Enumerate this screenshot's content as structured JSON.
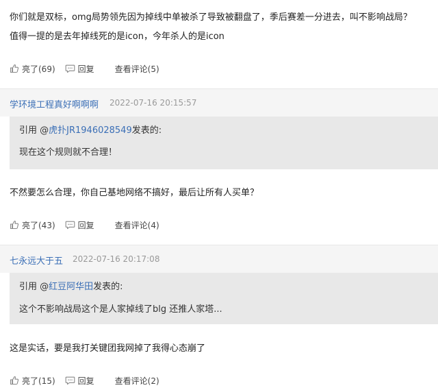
{
  "post_top": {
    "line1": "你们就是双标，omg局势领先因为掉线中单被杀了导致被翻盘了，季后赛差一分进去，叫不影响战局？",
    "line2": "值得一提的是去年掉线死的是icon，今年杀人的是icon",
    "like_label": "亮了(69)",
    "reply_label": "回复",
    "view_label": "查看评论(5)"
  },
  "post2": {
    "author": "学环境工程真好啊啊啊",
    "time": "2022-07-16 20:15:57",
    "quote_prefix": "引用 @",
    "quote_user": "虎扑JR1946028549",
    "quote_suffix": "发表的:",
    "quote_text": "现在这个规则就不合理！",
    "text": "不然要怎么合理，你自己基地网络不搞好，最后让所有人买单？",
    "like_label": "亮了(43)",
    "reply_label": "回复",
    "view_label": "查看评论(4)"
  },
  "post3": {
    "author": "七永远大于五",
    "time": "2022-07-16 20:17:08",
    "quote_prefix": "引用 @",
    "quote_user": "红豆阿华田",
    "quote_suffix": "发表的:",
    "quote_text": "这个不影响战局这个是人家掉线了blg 还推人家塔...",
    "text": "这是实话，要是我打关键团我网掉了我得心态崩了",
    "like_label": "亮了(15)",
    "reply_label": "回复",
    "view_label": "查看评论(2)"
  },
  "icons": {
    "like": "thumbs-up-icon",
    "reply": "chat-bubble-icon"
  }
}
